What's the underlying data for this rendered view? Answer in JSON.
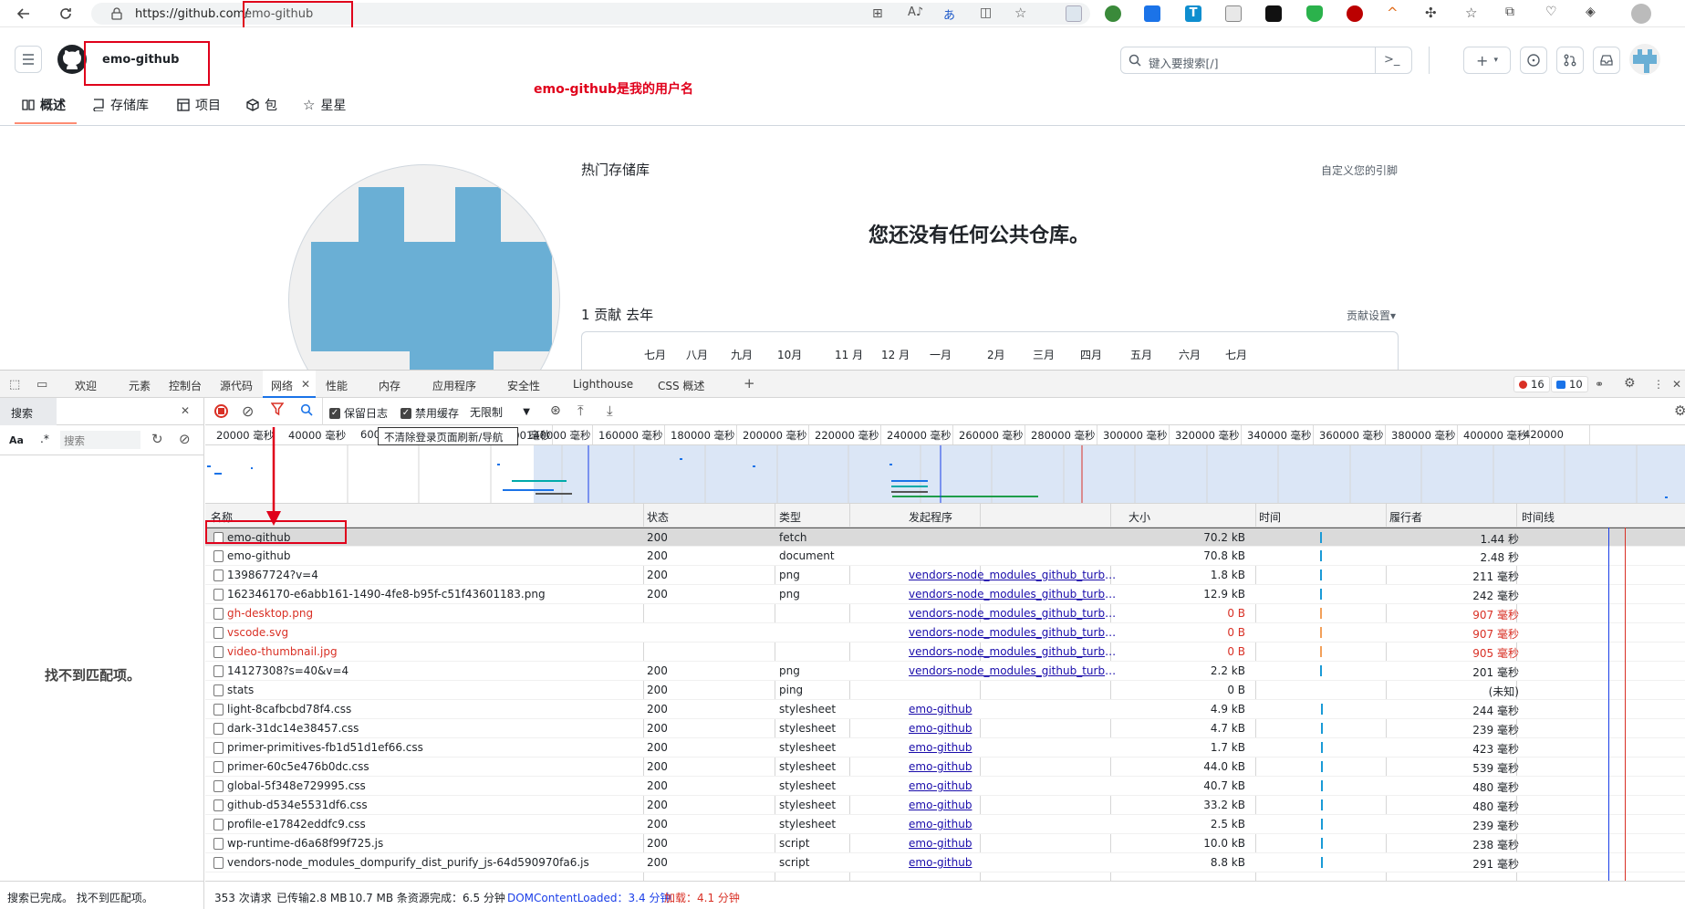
{
  "browser": {
    "url_base": "https://github.com/",
    "url_path": "emo-github"
  },
  "github": {
    "username": "emo-github",
    "annotation": "emo-github是我的用户名",
    "search_placeholder": "键入要搜索[/]",
    "tabs": [
      "概述",
      "存储库",
      "项目",
      "包",
      "星星"
    ],
    "popular_heading": "热门存储库",
    "customize_pins": "自定义您的引脚",
    "no_repos": "您还没有任何公共仓库。",
    "contrib_title": "1 贡献 去年",
    "contrib_settings": "贡献设置▾",
    "months": [
      "七月",
      "八月",
      "九月",
      "10月",
      "11 月",
      "12 月",
      "一月",
      "2月",
      "三月",
      "四月",
      "五月",
      "六月",
      "七月"
    ]
  },
  "devtools": {
    "tabs": [
      "欢迎",
      "元素",
      "控制台",
      "源代码",
      "网络",
      "性能",
      "内存",
      "应用程序",
      "安全性",
      "Lighthouse",
      "CSS 概述"
    ],
    "error_count": "16",
    "message_count": "10",
    "left_search_tab": "搜索",
    "left_search_placeholder": "搜索",
    "left_no_match": "找不到匹配项。",
    "left_status": "搜索已完成。 找不到匹配项。",
    "toolbar": {
      "preserve_log": "保留日志",
      "disable_cache": "禁用缓存",
      "throttle": "无限制",
      "tooltip": "不清除登录页面刷新/导航"
    },
    "ruler_ticks": [
      "20000 毫秒",
      "40000 毫秒",
      "600",
      "0",
      "120000 毫秒",
      "140000 毫秒",
      "160000 毫秒",
      "180000 毫秒",
      "200000 毫秒",
      "220000 毫秒",
      "240000 毫秒",
      "260000 毫秒",
      "280000 毫秒",
      "300000 毫秒",
      "320000 毫秒",
      "340000 毫秒",
      "360000 毫秒",
      "380000 毫秒",
      "400000 毫秒",
      "420000"
    ],
    "columns": [
      "名称",
      "状态",
      "类型",
      "发起程序",
      "大小",
      "时间",
      "履行者",
      "时间线"
    ],
    "rows": [
      {
        "name": "emo-github",
        "status": "200",
        "type": "fetch",
        "initiator": "",
        "size": "70.2 kB",
        "time": "1.44 秒",
        "error": false
      },
      {
        "name": "emo-github",
        "status": "200",
        "type": "document",
        "initiator": "",
        "size": "70.8 kB",
        "time": "2.48 秒",
        "error": false
      },
      {
        "name": "139867724?v=4",
        "status": "200",
        "type": "png",
        "initiator": "vendors-node_modules_github_turbo_dis...",
        "size": "1.8 kB",
        "time": "211 毫秒",
        "error": false
      },
      {
        "name": "162346170-e6abb161-1490-4fe8-b95f-c51f43601183.png",
        "status": "200",
        "type": "png",
        "initiator": "vendors-node_modules_github_turbo_dis...",
        "size": "12.9 kB",
        "time": "242 毫秒",
        "error": false
      },
      {
        "name": "gh-desktop.png",
        "status": "",
        "type": "",
        "initiator": "vendors-node_modules_github_turbo_dis...",
        "size": "0 B",
        "time": "907 毫秒",
        "error": true
      },
      {
        "name": "vscode.svg",
        "status": "",
        "type": "",
        "initiator": "vendors-node_modules_github_turbo_dis...",
        "size": "0 B",
        "time": "907 毫秒",
        "error": true
      },
      {
        "name": "video-thumbnail.jpg",
        "status": "",
        "type": "",
        "initiator": "vendors-node_modules_github_turbo_dis...",
        "size": "0 B",
        "time": "905 毫秒",
        "error": true
      },
      {
        "name": "14127308?s=40&v=4",
        "status": "200",
        "type": "png",
        "initiator": "vendors-node_modules_github_turbo_dis...",
        "size": "2.2 kB",
        "time": "201 毫秒",
        "error": false
      },
      {
        "name": "stats",
        "status": "200",
        "type": "ping",
        "initiator": "",
        "size": "0 B",
        "time": "(未知)",
        "error": false
      },
      {
        "name": "light-8cafbcbd78f4.css",
        "status": "200",
        "type": "stylesheet",
        "initiator": "emo-github",
        "size": "4.9 kB",
        "time": "244 毫秒",
        "error": false
      },
      {
        "name": "dark-31dc14e38457.css",
        "status": "200",
        "type": "stylesheet",
        "initiator": "emo-github",
        "size": "4.7 kB",
        "time": "239 毫秒",
        "error": false
      },
      {
        "name": "primer-primitives-fb1d51d1ef66.css",
        "status": "200",
        "type": "stylesheet",
        "initiator": "emo-github",
        "size": "1.7 kB",
        "time": "423 毫秒",
        "error": false
      },
      {
        "name": "primer-60c5e476b0dc.css",
        "status": "200",
        "type": "stylesheet",
        "initiator": "emo-github",
        "size": "44.0 kB",
        "time": "539 毫秒",
        "error": false
      },
      {
        "name": "global-5f348e729995.css",
        "status": "200",
        "type": "stylesheet",
        "initiator": "emo-github",
        "size": "40.7 kB",
        "time": "480 毫秒",
        "error": false
      },
      {
        "name": "github-d534e5531df6.css",
        "status": "200",
        "type": "stylesheet",
        "initiator": "emo-github",
        "size": "33.2 kB",
        "time": "480 毫秒",
        "error": false
      },
      {
        "name": "profile-e17842eddfc9.css",
        "status": "200",
        "type": "stylesheet",
        "initiator": "emo-github",
        "size": "2.5 kB",
        "time": "239 毫秒",
        "error": false
      },
      {
        "name": "wp-runtime-d6a68f99f725.js",
        "status": "200",
        "type": "script",
        "initiator": "emo-github",
        "size": "10.0 kB",
        "time": "238 毫秒",
        "error": false
      },
      {
        "name": "vendors-node_modules_dompurify_dist_purify_js-64d590970fa6.js",
        "status": "200",
        "type": "script",
        "initiator": "emo-github",
        "size": "8.8 kB",
        "time": "291 毫秒",
        "error": false
      }
    ],
    "summary": {
      "requests": "353 次请求",
      "transferred": "已传输2.8 MB",
      "resources": "10.7 MB 条资源",
      "finish": "完成：6.5 分钟",
      "dcl": "DOMContentLoaded：3.4 分钟",
      "load": "加载：4.1 分钟"
    }
  },
  "colors": {
    "accent_red": "#e0001b",
    "avatar_blue": "#6aafd5",
    "link_blue": "#1a0dab",
    "error_red": "#d93025"
  }
}
